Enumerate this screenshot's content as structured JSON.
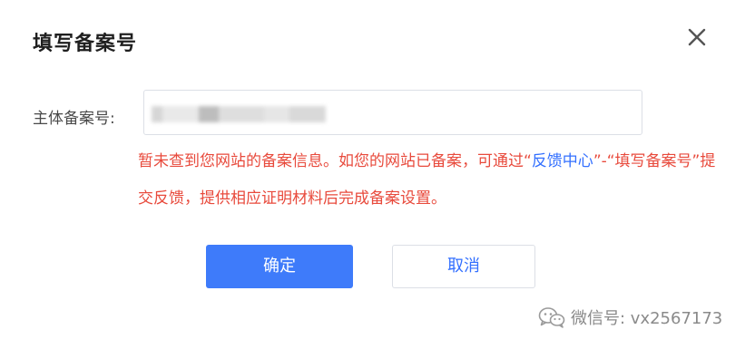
{
  "dialog": {
    "title": "填写备案号",
    "close_icon": "close-icon",
    "field": {
      "label": "主体备案号:",
      "value_redacted": true
    },
    "error": {
      "part1": "暂未查到您网站的备案信息。如您的网站已备案，可通过“",
      "link": "反馈中心",
      "part2": "”-“填写备案号”提交反馈，提供相应证明材料后完成备案设置。"
    },
    "buttons": {
      "confirm": "确定",
      "cancel": "取消"
    }
  },
  "watermark": {
    "text": "微信号: vx2567173",
    "icon": "wechat-icon"
  },
  "colors": {
    "primary": "#3e7bfa",
    "link": "#3370ff",
    "error": "#e84a3c",
    "border": "#dcdfe6"
  }
}
